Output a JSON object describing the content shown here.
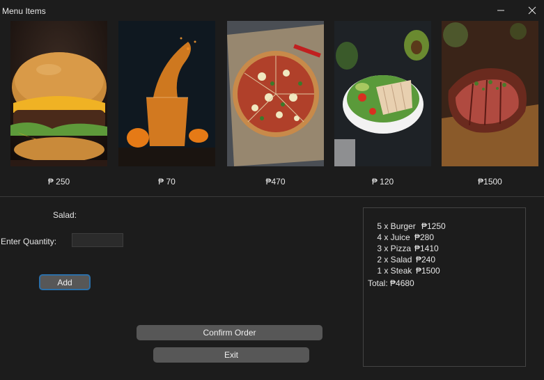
{
  "window": {
    "title": "Menu Items"
  },
  "menu_items": [
    {
      "name": "Burger",
      "image_icon": "burger-photo",
      "price": "₱ 250"
    },
    {
      "name": "Juice",
      "image_icon": "juice-photo",
      "price": "₱ 70"
    },
    {
      "name": "Pizza",
      "image_icon": "pizza-photo",
      "price": "₱470"
    },
    {
      "name": "Salad",
      "image_icon": "salad-photo",
      "price": "₱ 120"
    },
    {
      "name": "Steak",
      "image_icon": "steak-photo",
      "price": "₱1500"
    }
  ],
  "form": {
    "selected_item_label": "Salad:",
    "quantity_label": "Enter Quantity:",
    "quantity_value": "",
    "add_label": "Add"
  },
  "actions": {
    "confirm_label": "Confirm Order",
    "exit_label": "Exit"
  },
  "order": {
    "lines": [
      {
        "item": "5 x Burger",
        "amount": "₱1250"
      },
      {
        "item": "4 x Juice",
        "amount": "₱280"
      },
      {
        "item": "3 x Pizza",
        "amount": "₱1410"
      },
      {
        "item": "2 x Salad",
        "amount": "₱240"
      },
      {
        "item": "1 x Steak",
        "amount": "₱1500"
      }
    ],
    "total": "Total: ₱4680"
  },
  "colors": {
    "background": "#1c1c1c",
    "button": "#575757",
    "focus_border": "#2b6fa8"
  }
}
